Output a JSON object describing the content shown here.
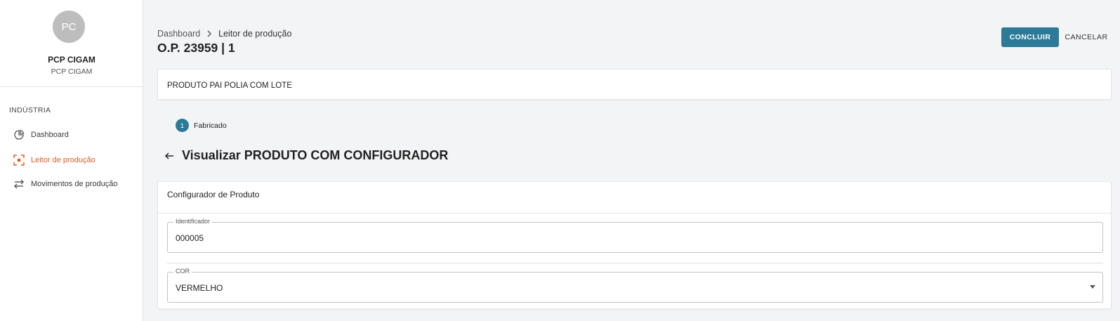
{
  "sidebar": {
    "avatar_initials": "PC",
    "user_name": "PCP CIGAM",
    "user_subtitle": "PCP CIGAM",
    "section_label": "INDÚSTRIA",
    "items": [
      {
        "label": "Dashboard",
        "icon": "pie-chart-icon",
        "active": false
      },
      {
        "label": "Leitor de produção",
        "icon": "scanner-icon",
        "active": true
      },
      {
        "label": "Movimentos de produção",
        "icon": "swap-arrows-icon",
        "active": false
      }
    ]
  },
  "header": {
    "breadcrumb": [
      "Dashboard",
      "Leitor de produção"
    ],
    "title": "O.P. 23959 | 1",
    "confirm_label": "CONCLUIR",
    "cancel_label": "CANCELAR"
  },
  "product": {
    "name": "PRODUTO PAI POLIA COM LOTE"
  },
  "stepper": {
    "steps": [
      {
        "number": "1",
        "label": "Fabricado"
      }
    ]
  },
  "view": {
    "title": "Visualizar PRODUTO COM CONFIGURADOR"
  },
  "configurator": {
    "title": "Configurador de Produto",
    "fields": [
      {
        "label": "Identificador",
        "value": "000005",
        "type": "text"
      },
      {
        "label": "COR",
        "value": "VERMELHO",
        "type": "select"
      }
    ]
  },
  "colors": {
    "primary": "#2c7a98",
    "active_nav": "#e05a24",
    "background": "#f3f4f6"
  }
}
